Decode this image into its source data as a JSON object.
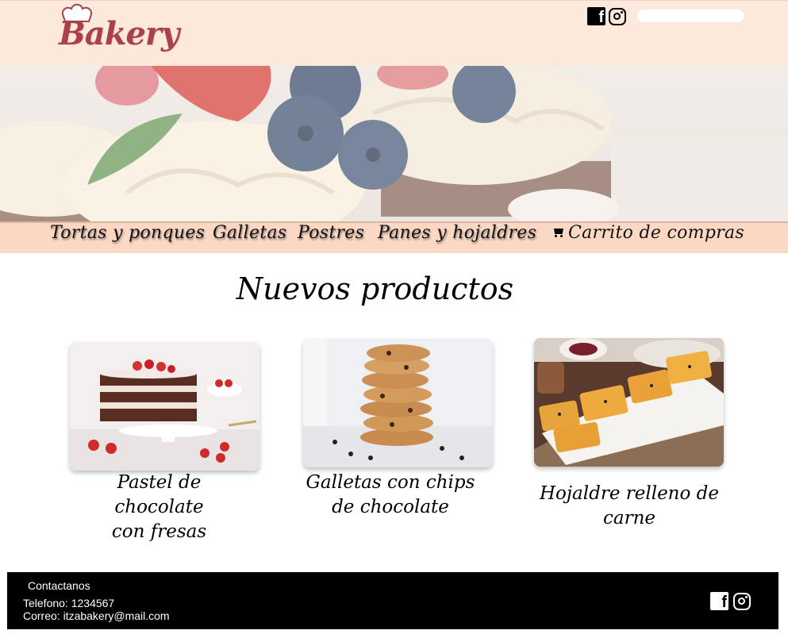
{
  "header": {
    "logo_text": "Bakery",
    "search": {
      "placeholder": "",
      "value": ""
    },
    "social": [
      "facebook-icon",
      "instagram-icon"
    ]
  },
  "nav": {
    "items": [
      {
        "label": "Tortas y ponques"
      },
      {
        "label": "Galletas"
      },
      {
        "label": "Postres"
      },
      {
        "label": "Panes y hojaldres"
      },
      {
        "label": "Carrito de compras",
        "icon": "cart-icon"
      }
    ]
  },
  "main": {
    "title": "Nuevos productos",
    "products": [
      {
        "line1": "Pastel de chocolate",
        "line2": "con fresas"
      },
      {
        "line1": "Galletas con chips",
        "line2": "de chocolate"
      },
      {
        "line1": "Hojaldre relleno de carne"
      }
    ]
  },
  "footer": {
    "contact_label": "Contactanos",
    "phone": "Telefono: 1234567",
    "email": "Correo: itzabakery@mail.com"
  },
  "colors": {
    "header_bg": "#fde8dc",
    "nav_bg": "#fbd8c3",
    "logo": "#a9414d",
    "footer_bg": "#000000"
  }
}
